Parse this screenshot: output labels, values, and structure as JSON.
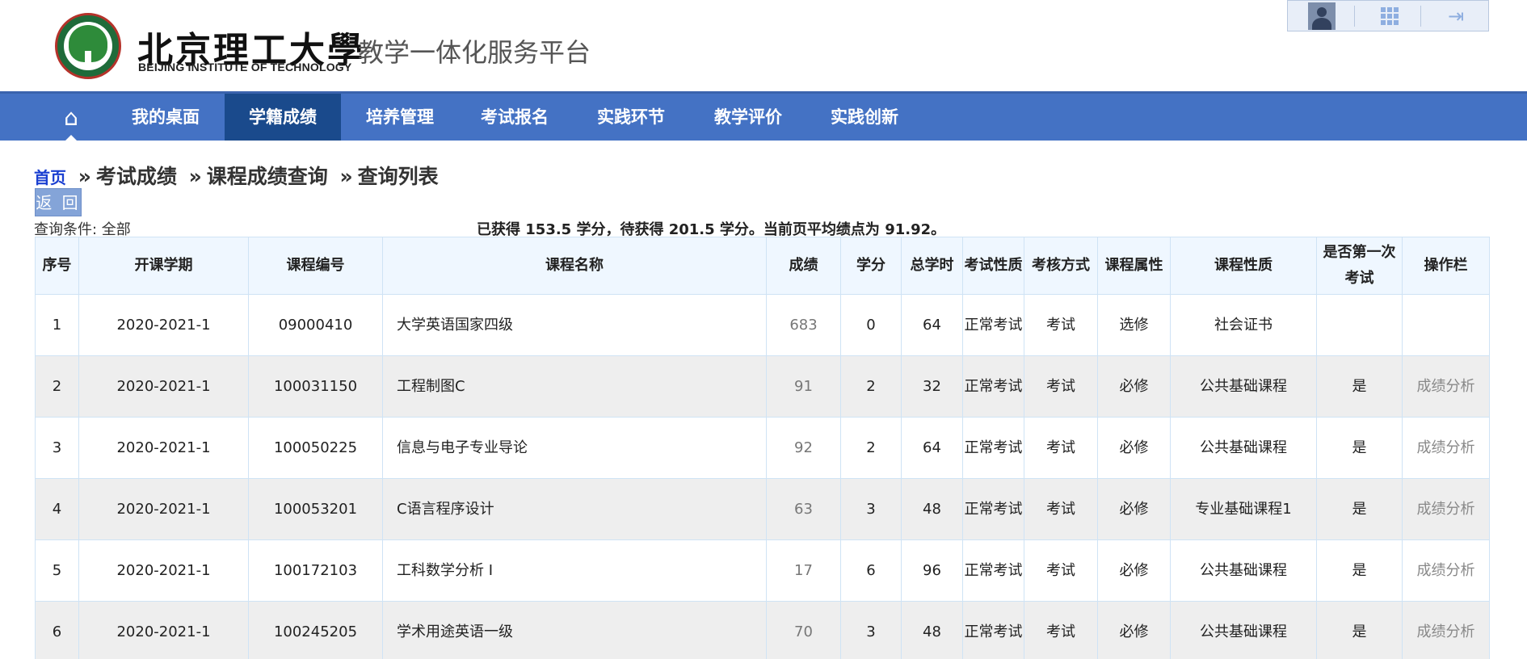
{
  "header": {
    "logo_cn": "北京理工大學",
    "logo_en": "BEIJING INSTITUTE OF TECHNOLOGY",
    "platform_title": "教学一体化服务平台",
    "icons": [
      "avatar",
      "apps-grid-icon",
      "logout-icon"
    ]
  },
  "nav": {
    "home_icon": "home-icon",
    "items": [
      {
        "label": "我的桌面",
        "active": false
      },
      {
        "label": "学籍成绩",
        "active": true
      },
      {
        "label": "培养管理",
        "active": false
      },
      {
        "label": "考试报名",
        "active": false
      },
      {
        "label": "实践环节",
        "active": false
      },
      {
        "label": "教学评价",
        "active": false
      },
      {
        "label": "实践创新",
        "active": false
      }
    ]
  },
  "breadcrumb": {
    "home": "首页",
    "separator": "»",
    "items": [
      "考试成绩",
      "课程成绩查询",
      "查询列表"
    ]
  },
  "back_button": "返 回",
  "query_condition": "查询条件: 全部",
  "summary": "已获得 153.5 学分，待获得 201.5 学分。当前页平均绩点为 91.92。",
  "table": {
    "headers": [
      "序号",
      "开课学期",
      "课程编号",
      "课程名称",
      "成绩",
      "学分",
      "总学时",
      "考试性质",
      "考核方式",
      "课程属性",
      "课程性质",
      "是否第一次考试",
      "操作栏"
    ],
    "rows": [
      [
        "1",
        "2020-2021-1",
        "09000410",
        "大学英语国家四级",
        "683",
        "0",
        "64",
        "正常考试",
        "考试",
        "选修",
        "社会证书",
        "",
        ""
      ],
      [
        "2",
        "2020-2021-1",
        "100031150",
        "工程制图C",
        "91",
        "2",
        "32",
        "正常考试",
        "考试",
        "必修",
        "公共基础课程",
        "是",
        "成绩分析"
      ],
      [
        "3",
        "2020-2021-1",
        "100050225",
        "信息与电子专业导论",
        "92",
        "2",
        "64",
        "正常考试",
        "考试",
        "必修",
        "公共基础课程",
        "是",
        "成绩分析"
      ],
      [
        "4",
        "2020-2021-1",
        "100053201",
        "C语言程序设计",
        "63",
        "3",
        "48",
        "正常考试",
        "考试",
        "必修",
        "专业基础课程1",
        "是",
        "成绩分析"
      ],
      [
        "5",
        "2020-2021-1",
        "100172103",
        "工科数学分析 I",
        "17",
        "6",
        "96",
        "正常考试",
        "考试",
        "必修",
        "公共基础课程",
        "是",
        "成绩分析"
      ],
      [
        "6",
        "2020-2021-1",
        "100245205",
        "学术用途英语一级",
        "70",
        "3",
        "48",
        "正常考试",
        "考试",
        "必修",
        "公共基础课程",
        "是",
        "成绩分析"
      ]
    ]
  },
  "colors": {
    "nav_bg": "#4472c4",
    "nav_active": "#1a4a8c",
    "link_blue": "#1a3fd1",
    "header_row_bg": "#eff7ff",
    "alt_row_bg": "#eeeeee"
  }
}
